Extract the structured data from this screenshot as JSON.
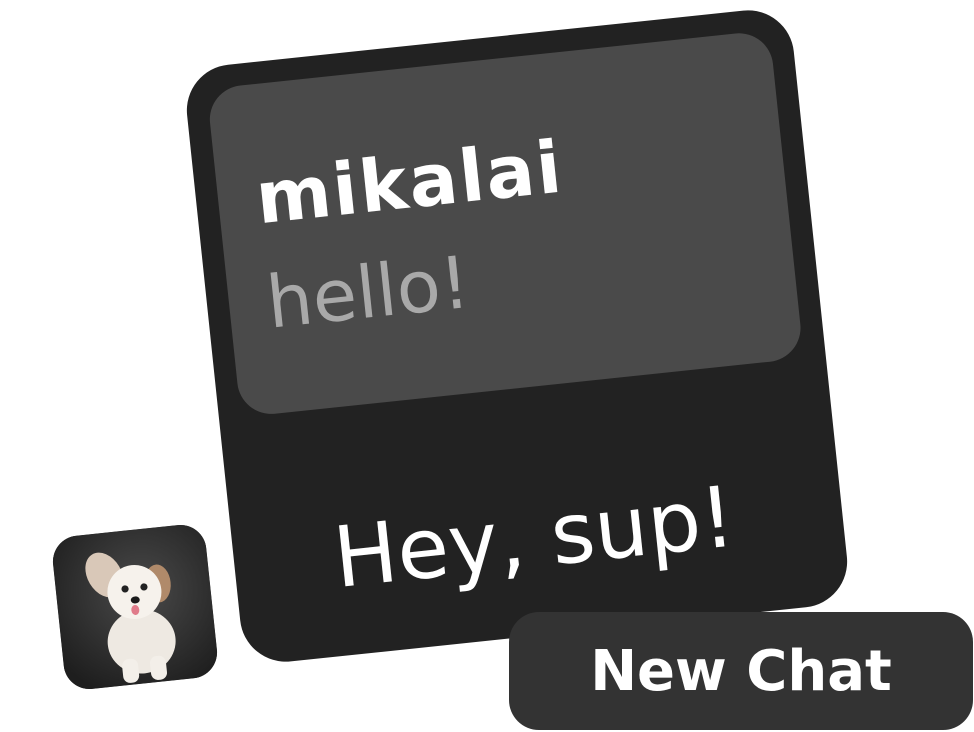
{
  "conversation": {
    "incoming": {
      "sender": "mikalai",
      "message": "hello!"
    },
    "reply": "Hey, sup!"
  },
  "avatar": {
    "icon": "dog-photo-avatar"
  },
  "actions": {
    "new_chat_label": "New Chat"
  },
  "colors": {
    "card_background": "#222222",
    "bubble_background": "#4a4a4a",
    "button_background": "#333333",
    "primary_text": "#ffffff",
    "secondary_text": "#a9a9a9"
  }
}
